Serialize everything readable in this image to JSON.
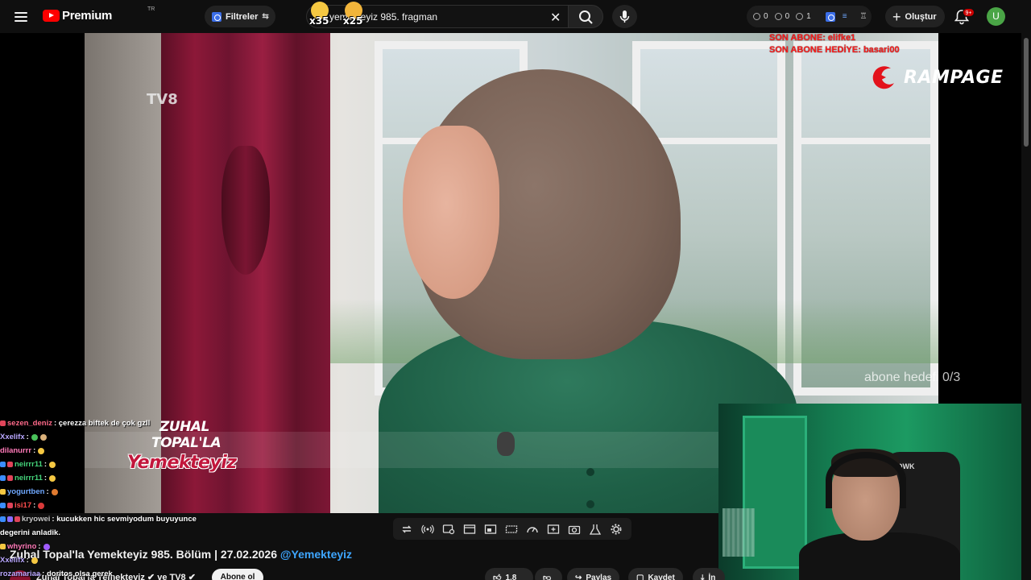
{
  "topbar": {
    "logo_text": "Premium",
    "logo_superscript": "TR",
    "filter_label": "Filtreler",
    "search_value": "yemekteyiz 985. fragman",
    "stats": [
      "0",
      "0",
      "1"
    ],
    "create_label": "Oluştur",
    "notification_badge": "9+",
    "avatar_letter": "U",
    "emotes": [
      {
        "count": "x35",
        "color": "#f5c842"
      },
      {
        "count": "x25",
        "color": "#f2b53b"
      }
    ]
  },
  "overlay": {
    "son_abone": "SON ABONE: elifke1",
    "son_abone_hediye": "SON ABONE HEDİYE: basari00",
    "sponsor": "RAMPAGE",
    "goal": "abone hedefi 0/3",
    "channel_logo": "TV8",
    "show_logo": [
      "ZUHAL",
      "TOPAL'LA",
      "Yemekteyiz"
    ]
  },
  "chat": [
    {
      "user": "sezen_deniz",
      "color": "#ff6a8a",
      "msg": ": çerezza biftek de çok gzll",
      "badges": [
        "#e0445a"
      ],
      "emotes": []
    },
    {
      "user": "Xxelifx",
      "color": "#b9a7ff",
      "msg": ":",
      "badges": [],
      "emotes": [
        "#49c25a",
        "#d9b07a"
      ]
    },
    {
      "user": "dilanurrr",
      "color": "#ff7ab8",
      "msg": ":",
      "badges": [],
      "emotes": [
        "#f5c842"
      ]
    },
    {
      "user": "neirrr11",
      "color": "#44d37a",
      "msg": ":",
      "badges": [
        "#3a8dff",
        "#e0445a"
      ],
      "emotes": [
        "#f5c842"
      ]
    },
    {
      "user": "neirrr11",
      "color": "#44d37a",
      "msg": ":",
      "badges": [
        "#3a8dff",
        "#e0445a"
      ],
      "emotes": [
        "#f5c842"
      ]
    },
    {
      "user": "yogurtben",
      "color": "#6fa8ff",
      "msg": ":",
      "badges": [
        "#f5c842"
      ],
      "emotes": [
        "#e07a2f"
      ]
    },
    {
      "user": "isi17",
      "color": "#ff4d4d",
      "msg": ":",
      "badges": [
        "#3a8dff",
        "#e0445a"
      ],
      "emotes": [
        "#d93a3a"
      ]
    },
    {
      "user": "kryowei",
      "color": "#c8c8c8",
      "msg": ": kucukken hic sevmiyodum buyuyunce",
      "badges": [
        "#3a8dff",
        "#8a6cff",
        "#e0445a"
      ],
      "emotes": []
    },
    {
      "user": "",
      "color": "#ffffff",
      "msg": "degerini anladik.",
      "badges": [],
      "emotes": []
    },
    {
      "user": "whyrino",
      "color": "#ff7ab8",
      "msg": ":",
      "badges": [
        "#f5c842"
      ],
      "emotes": [
        "#a05cff"
      ]
    },
    {
      "user": "Xxelifx",
      "color": "#b9a7ff",
      "msg": ":",
      "badges": [],
      "emotes": [
        "#f5c842"
      ]
    },
    {
      "user": "rozamariaa",
      "color": "#b9a7ff",
      "msg": ": doritos olsa gerek",
      "badges": [],
      "emotes": []
    }
  ],
  "video": {
    "title": "Zuhal Topal'la Yemekteyiz 985. Bölüm | 27.02.2026",
    "handle": "@Yemekteyiz",
    "channel_line": "Zuhal Topal'la Yemekteyiz ✔ ve TV8 ✔",
    "subscribe_label": "Abone ol",
    "likes": "1,8",
    "share_label": "Paylaş",
    "save_label": "Kaydet",
    "more_label": "İn"
  },
  "colors": {
    "background": "#0f0f0f",
    "accent_red": "#ff0000",
    "link_blue": "#3ea6ff"
  }
}
